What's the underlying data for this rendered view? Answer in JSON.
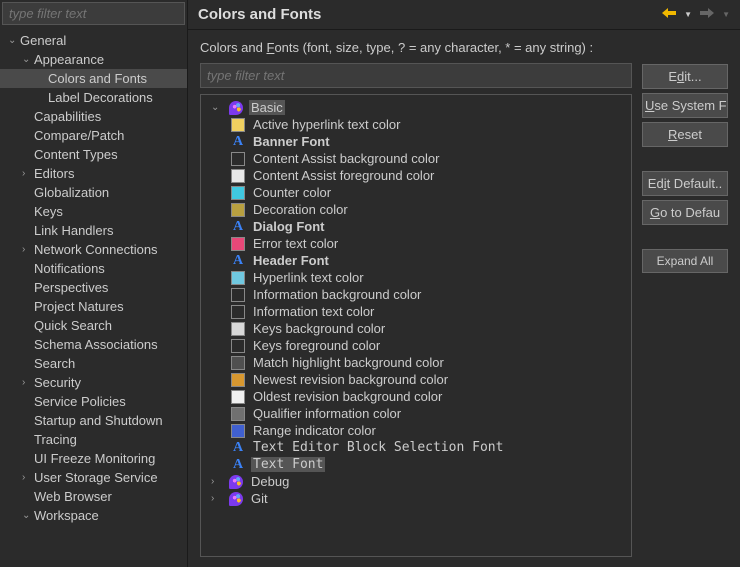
{
  "sidebar": {
    "filter_placeholder": "type filter text",
    "items": [
      {
        "label": "General",
        "indent": 1,
        "expanded": true
      },
      {
        "label": "Appearance",
        "indent": 2,
        "expanded": true
      },
      {
        "label": "Colors and Fonts",
        "indent": 3,
        "selected": true
      },
      {
        "label": "Label Decorations",
        "indent": 3
      },
      {
        "label": "Capabilities",
        "indent": 2
      },
      {
        "label": "Compare/Patch",
        "indent": 2
      },
      {
        "label": "Content Types",
        "indent": 2
      },
      {
        "label": "Editors",
        "indent": 2,
        "hasChildren": true
      },
      {
        "label": "Globalization",
        "indent": 2
      },
      {
        "label": "Keys",
        "indent": 2
      },
      {
        "label": "Link Handlers",
        "indent": 2
      },
      {
        "label": "Network Connections",
        "indent": 2,
        "hasChildren": true
      },
      {
        "label": "Notifications",
        "indent": 2
      },
      {
        "label": "Perspectives",
        "indent": 2
      },
      {
        "label": "Project Natures",
        "indent": 2
      },
      {
        "label": "Quick Search",
        "indent": 2
      },
      {
        "label": "Schema Associations",
        "indent": 2
      },
      {
        "label": "Search",
        "indent": 2
      },
      {
        "label": "Security",
        "indent": 2,
        "hasChildren": true
      },
      {
        "label": "Service Policies",
        "indent": 2
      },
      {
        "label": "Startup and Shutdown",
        "indent": 2
      },
      {
        "label": "Tracing",
        "indent": 2
      },
      {
        "label": "UI Freeze Monitoring",
        "indent": 2
      },
      {
        "label": "User Storage Service",
        "indent": 2,
        "hasChildren": true
      },
      {
        "label": "Web Browser",
        "indent": 2
      },
      {
        "label": "Workspace",
        "indent": 2,
        "expanded": true
      }
    ]
  },
  "header": {
    "title": "Colors and Fonts"
  },
  "content": {
    "desc_prefix": "Colors and ",
    "desc_underline": "F",
    "desc_suffix": "onts (font, size, type, ? = any character, * = any string) :",
    "filter_placeholder": "type filter text",
    "tree": [
      {
        "label": "Basic",
        "icon": "palette",
        "indent": 1,
        "expanded": true,
        "selected": true
      },
      {
        "label": "Active hyperlink text color",
        "swatch": "#f0d060",
        "indent": 2
      },
      {
        "label": "Banner Font",
        "icon": "font",
        "indent": 2,
        "bold": true
      },
      {
        "label": "Content Assist background color",
        "swatch": "#2b2b2b",
        "indent": 2
      },
      {
        "label": "Content Assist foreground color",
        "swatch": "#e8e8e8",
        "indent": 2
      },
      {
        "label": "Counter color",
        "swatch": "#40c8e0",
        "indent": 2
      },
      {
        "label": "Decoration color",
        "swatch": "#b8a040",
        "indent": 2
      },
      {
        "label": "Dialog Font",
        "icon": "font",
        "indent": 2,
        "bold": true
      },
      {
        "label": "Error text color",
        "swatch": "#e84878",
        "indent": 2
      },
      {
        "label": "Header Font",
        "icon": "font",
        "indent": 2,
        "bold": true
      },
      {
        "label": "Hyperlink text color",
        "swatch": "#70c8e0",
        "indent": 2
      },
      {
        "label": "Information background color",
        "swatch": "#2b2b2b",
        "indent": 2
      },
      {
        "label": "Information text color",
        "swatch": "#2b2b2b",
        "indent": 2
      },
      {
        "label": "Keys background color",
        "swatch": "#d8d8d8",
        "indent": 2
      },
      {
        "label": "Keys foreground color",
        "swatch": "#2b2b2b",
        "indent": 2
      },
      {
        "label": "Match highlight background color",
        "swatch": "#505050",
        "indent": 2
      },
      {
        "label": "Newest revision background color",
        "swatch": "#d89830",
        "indent": 2
      },
      {
        "label": "Oldest revision background color",
        "swatch": "#f0f0f0",
        "indent": 2
      },
      {
        "label": "Qualifier information color",
        "swatch": "#707070",
        "indent": 2
      },
      {
        "label": "Range indicator color",
        "swatch": "#4060d0",
        "indent": 2
      },
      {
        "label": "Text Editor Block Selection Font",
        "icon": "font",
        "indent": 2,
        "mono": true
      },
      {
        "label": "Text Font",
        "icon": "font",
        "indent": 2,
        "mono": true,
        "selected": true
      },
      {
        "label": "Debug",
        "icon": "palette",
        "indent": 1,
        "hasChildren": true
      },
      {
        "label": "Git",
        "icon": "palette",
        "indent": 1,
        "hasChildren": true
      }
    ]
  },
  "buttons": {
    "edit": "Edit...",
    "use_system": "Use System Fo",
    "reset": "Reset",
    "edit_default": "Edit Default..",
    "go_default": "Go to Defau",
    "expand_all": "Expand All"
  }
}
